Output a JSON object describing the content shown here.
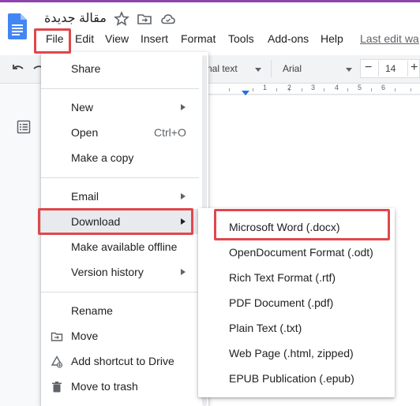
{
  "document": {
    "title": "مقالة جديدة",
    "last_edit": "Last edit wa"
  },
  "menubar": {
    "items": [
      "File",
      "Edit",
      "View",
      "Insert",
      "Format",
      "Tools",
      "Add-ons",
      "Help"
    ]
  },
  "toolbar": {
    "style_value": "nal text",
    "font_value": "Arial",
    "font_size": "14",
    "size_minus": "−",
    "size_plus": "+"
  },
  "ruler": {
    "numbers": [
      "1",
      "2",
      "3",
      "4",
      "5",
      "6"
    ]
  },
  "file_menu": {
    "items": [
      {
        "label": "Share"
      },
      {
        "label": "New",
        "submenu": true
      },
      {
        "label": "Open",
        "shortcut": "Ctrl+O"
      },
      {
        "label": "Make a copy"
      },
      {
        "label": "Email",
        "submenu": true
      },
      {
        "label": "Download",
        "submenu": true,
        "highlighted": true
      },
      {
        "label": "Make available offline"
      },
      {
        "label": "Version history",
        "submenu": true
      },
      {
        "label": "Rename"
      },
      {
        "label": "Move",
        "icon": "move-to-folder-icon"
      },
      {
        "label": "Add shortcut to Drive",
        "icon": "add-shortcut-icon"
      },
      {
        "label": "Move to trash",
        "icon": "trash-icon"
      }
    ]
  },
  "download_submenu": {
    "items": [
      {
        "label": "Microsoft Word (.docx)",
        "highlighted": true
      },
      {
        "label": "OpenDocument Format (.odt)"
      },
      {
        "label": "Rich Text Format (.rtf)"
      },
      {
        "label": "PDF Document (.pdf)"
      },
      {
        "label": "Plain Text (.txt)"
      },
      {
        "label": "Web Page (.html, zipped)"
      },
      {
        "label": "EPUB Publication (.epub)"
      }
    ]
  },
  "colors": {
    "docs_blue": "#4285f4",
    "highlight_red": "#e0474c",
    "hover_gray": "#e8eaed",
    "ruler_blue": "#1a73e8"
  }
}
